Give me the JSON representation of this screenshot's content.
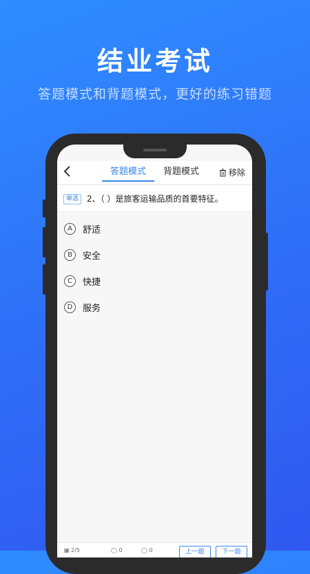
{
  "hero": {
    "title": "结业考试",
    "subtitle": "答题模式和背题模式，更好的练习错题"
  },
  "header": {
    "tabs": [
      {
        "label": "答题模式",
        "active": true
      },
      {
        "label": "背题模式",
        "active": false
      }
    ],
    "remove_label": "移除"
  },
  "question": {
    "type_badge": "单选",
    "text": "2、（  ）是旅客运输品质的首要特征。",
    "options": [
      {
        "letter": "A",
        "text": "舒适"
      },
      {
        "letter": "B",
        "text": "安全"
      },
      {
        "letter": "C",
        "text": "快捷"
      },
      {
        "letter": "D",
        "text": "服务"
      }
    ]
  },
  "bottom_bar": {
    "progress": "2/5",
    "correct_count": "0",
    "wrong_count": "0",
    "prev_label": "上一题",
    "next_label": "下一题"
  },
  "colors": {
    "accent": "#3a86e8",
    "background_top": "#2f8dff",
    "background_bottom": "#3058f0",
    "phone_frame": "#2b2b2b"
  }
}
